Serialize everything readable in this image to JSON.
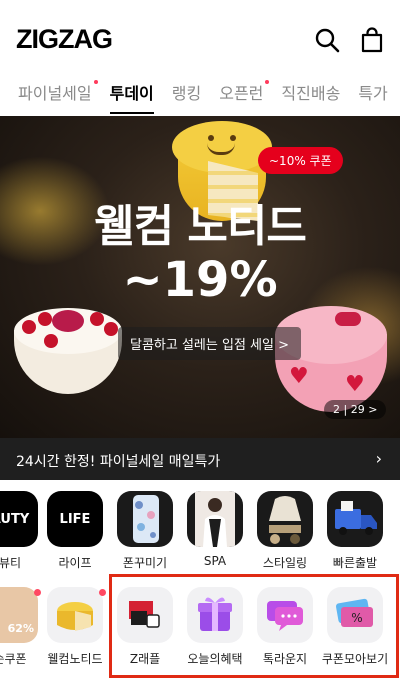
{
  "header": {
    "logo": "ZIGZAG"
  },
  "tabs": [
    {
      "label": "파이널세일",
      "active": false,
      "dot": true
    },
    {
      "label": "투데이",
      "active": true,
      "dot": false
    },
    {
      "label": "랭킹",
      "active": false,
      "dot": false
    },
    {
      "label": "오픈런",
      "active": false,
      "dot": true
    },
    {
      "label": "직진배송",
      "active": false,
      "dot": false
    },
    {
      "label": "특가",
      "active": false,
      "dot": false
    }
  ],
  "banner": {
    "coupon": "~10% 쿠폰",
    "headline_1": "웰컴 노티드",
    "headline_2": "~19%",
    "subtitle": "달콤하고 설레는 입점 세일 >",
    "pager": "2 | 29 >"
  },
  "promo": {
    "text": "24시간 한정! 파이널세일 매일특가",
    "arrow": "›"
  },
  "categories_row1": [
    {
      "label": "뷰티",
      "tile_text": "AUTY"
    },
    {
      "label": "라이프",
      "tile_text": "LIFE"
    },
    {
      "label": "폰꾸미기",
      "tile_text": ""
    },
    {
      "label": "SPA",
      "tile_text": ""
    },
    {
      "label": "스타일링",
      "tile_text": ""
    },
    {
      "label": "빠른출발",
      "tile_text": ""
    }
  ],
  "categories_row2": [
    {
      "label": "순쿠폰",
      "tile_text": "62%"
    },
    {
      "label": "웰컴노티드",
      "tile_text": ""
    },
    {
      "label": "Z래플",
      "tile_text": ""
    },
    {
      "label": "오늘의혜택",
      "tile_text": ""
    },
    {
      "label": "톡라운지",
      "tile_text": ""
    },
    {
      "label": "쿠폰모아보기",
      "tile_text": "%"
    }
  ],
  "colors": {
    "accent": "#e5001c",
    "highlight_border": "#e02a14",
    "dark": "#1f1f1f"
  }
}
